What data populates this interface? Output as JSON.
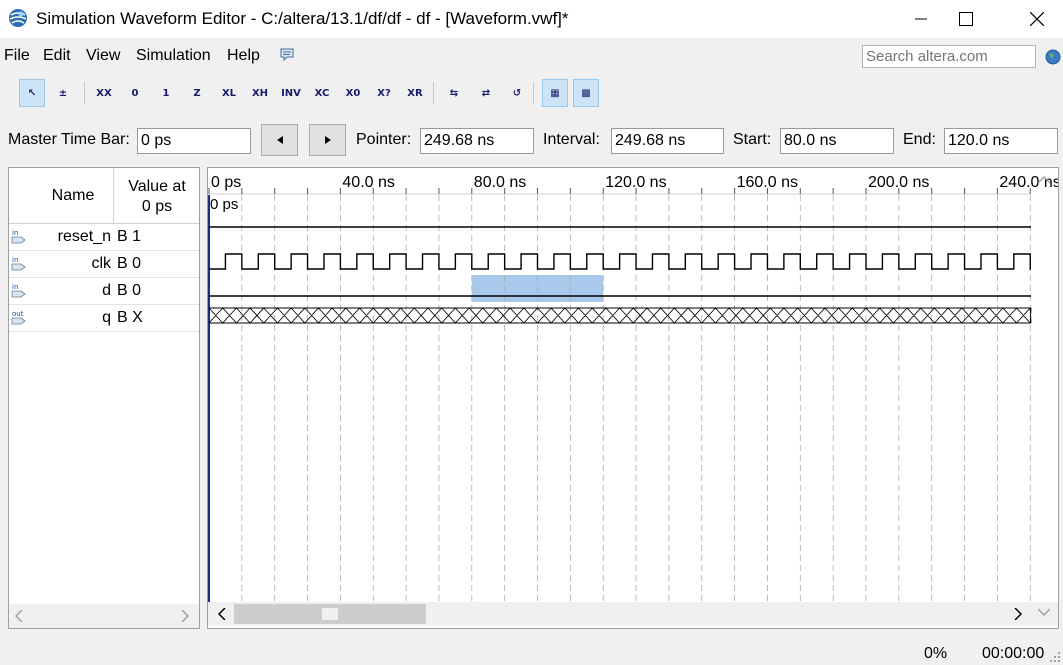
{
  "window": {
    "title": "Simulation Waveform Editor - C:/altera/13.1/df/df - df - [Waveform.vwf]*",
    "app_icon": "quartus-globe-icon"
  },
  "menu": {
    "items": [
      "File",
      "Edit",
      "View",
      "Simulation",
      "Help"
    ],
    "help_icon": "speech-bubble-icon",
    "search_placeholder": "Search altera.com"
  },
  "toolbar": {
    "buttons": [
      {
        "name": "selection-tool",
        "glyph": "↖",
        "active": true
      },
      {
        "name": "zoom-tool",
        "glyph": "±",
        "active": false
      },
      {
        "name": "forcing-unknown",
        "glyph": "XX",
        "active": false
      },
      {
        "name": "forcing-low",
        "glyph": "0",
        "active": false
      },
      {
        "name": "forcing-high",
        "glyph": "1",
        "active": false
      },
      {
        "name": "high-impedance",
        "glyph": "Z",
        "active": false
      },
      {
        "name": "weak-low",
        "glyph": "XL",
        "active": false
      },
      {
        "name": "weak-high",
        "glyph": "XH",
        "active": false
      },
      {
        "name": "invert",
        "glyph": "INV",
        "active": false
      },
      {
        "name": "count-value",
        "glyph": "XC",
        "active": false
      },
      {
        "name": "overwrite-clock",
        "glyph": "X0",
        "active": false
      },
      {
        "name": "arbitrary-value",
        "glyph": "X?",
        "active": false
      },
      {
        "name": "random-value",
        "glyph": "XR",
        "active": false
      },
      {
        "name": "functional-simulation",
        "glyph": "⇆",
        "active": false
      },
      {
        "name": "timing-simulation",
        "glyph": "⇄",
        "active": false
      },
      {
        "name": "netlist-writer",
        "glyph": "↺",
        "active": false
      },
      {
        "name": "snap-to-grid",
        "glyph": "▦",
        "active": true
      },
      {
        "name": "grid-settings",
        "glyph": "▩",
        "active": true
      }
    ]
  },
  "timebar": {
    "master_label": "Master Time Bar:",
    "master_value": "0 ps",
    "pointer_label": "Pointer:",
    "pointer_value": "249.68 ns",
    "interval_label": "Interval:",
    "interval_value": "249.68 ns",
    "start_label": "Start:",
    "start_value": "80.0 ns",
    "end_label": "End:",
    "end_value": "120.0 ns"
  },
  "signals": {
    "name_header": "Name",
    "value_header_line1": "Value at",
    "value_header_line2": "0 ps",
    "rows": [
      {
        "type_icon": "input-pin-icon",
        "type_text": "in",
        "name": "reset_n",
        "value": "B 1",
        "wave": "high"
      },
      {
        "type_icon": "input-pin-icon",
        "type_text": "in",
        "name": "clk",
        "value": "B 0",
        "wave": "clock"
      },
      {
        "type_icon": "input-pin-icon",
        "type_text": "in",
        "name": "d",
        "value": "B 0",
        "wave": "low"
      },
      {
        "type_icon": "output-pin-icon",
        "type_text": "out",
        "name": "q",
        "value": "B X",
        "wave": "unknown"
      }
    ]
  },
  "waveform": {
    "ruler_labels": [
      "0 ps",
      "40.0 ns",
      "80.0 ns",
      "120.0 ns",
      "160.0 ns",
      "200.0 ns",
      "240.0 ns"
    ],
    "cursor_label": "0 ps",
    "clock_period_ns": 10,
    "selection_ns": [
      80,
      120
    ],
    "visible_range_ns": [
      0,
      250
    ],
    "selection_color": "#a9c9ec"
  },
  "status": {
    "progress": "0%",
    "elapsed": "00:00:00"
  }
}
